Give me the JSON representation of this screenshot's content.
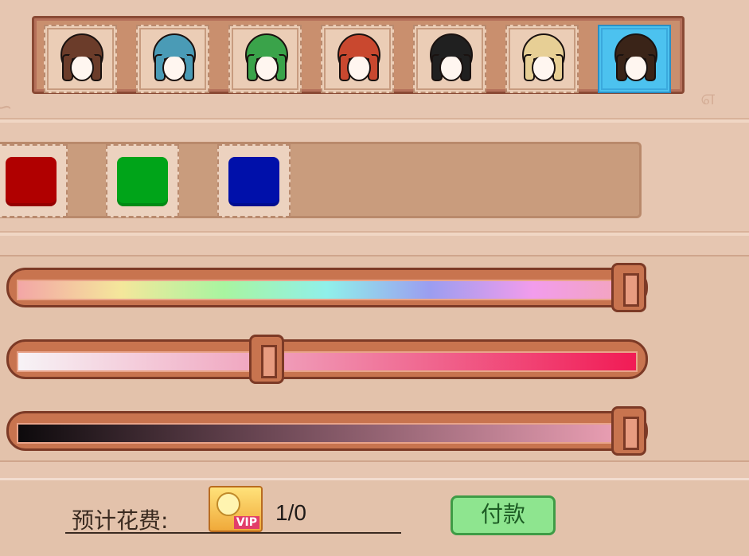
{
  "hair_styles": [
    {
      "name": "brown-bob",
      "color": "#6b3c2a"
    },
    {
      "name": "blue-buns",
      "color": "#4a9bb6"
    },
    {
      "name": "green-ponytail",
      "color": "#3aa34a"
    },
    {
      "name": "red-long",
      "color": "#c9482f"
    },
    {
      "name": "black-curly",
      "color": "#202020"
    },
    {
      "name": "blonde-short",
      "color": "#e7cf95"
    },
    {
      "name": "dark-brown-short",
      "color": "#3a2418"
    }
  ],
  "selected_hair_index": 6,
  "swatches": [
    {
      "name": "red",
      "color": "#b00000"
    },
    {
      "name": "green",
      "color": "#00a419"
    },
    {
      "name": "blue",
      "color": "#0010aa"
    }
  ],
  "sliders": {
    "hue": 1.0,
    "saturation": 0.4,
    "brightness": 1.0
  },
  "cost": {
    "label": "预计花费:",
    "value": "1/0",
    "vip_badge": "VIP"
  },
  "pay_button": "付款"
}
